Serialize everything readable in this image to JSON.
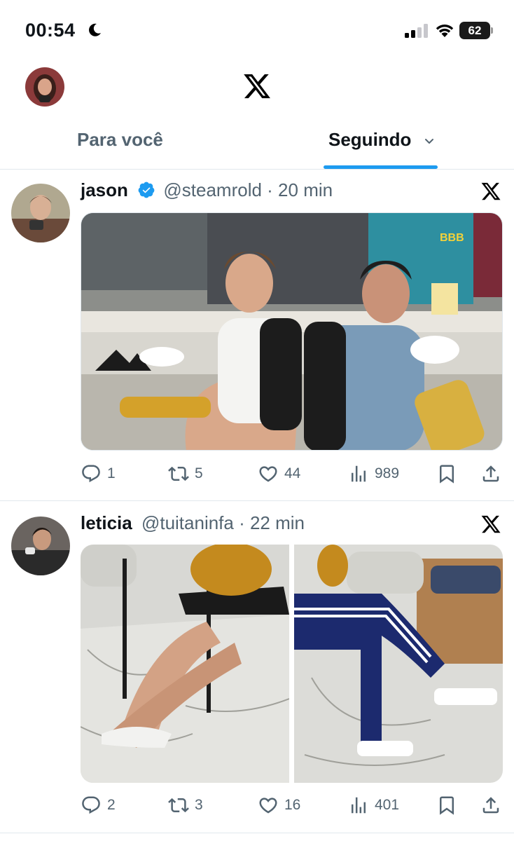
{
  "status_bar": {
    "time": "00:54",
    "battery": "62",
    "icons": [
      "moon-icon",
      "signal-icon",
      "wifi-icon",
      "battery-icon"
    ]
  },
  "header": {
    "logo": "x-logo",
    "avatar": "profile-avatar"
  },
  "tabs": [
    {
      "label": "Para você",
      "active": false
    },
    {
      "label": "Seguindo",
      "active": true
    }
  ],
  "colors": {
    "accent": "#1d9bf0",
    "text": "#0f1419",
    "secondary": "#536471",
    "divider": "#e1e8ed"
  },
  "tweets": [
    {
      "name": "jason",
      "verified": true,
      "handle": "@steamrold",
      "time": "20 min",
      "meta": "@steamrold · 20 min",
      "media": "single-photo",
      "replies": "1",
      "retweets": "5",
      "likes": "44",
      "views": "989"
    },
    {
      "name": "leticia",
      "verified": false,
      "handle": "@tuitaninfa",
      "time": "22 min",
      "meta": "@tuitaninfa · 22 min",
      "media": "two-photos",
      "replies": "2",
      "retweets": "3",
      "likes": "16",
      "views": "401"
    }
  ]
}
